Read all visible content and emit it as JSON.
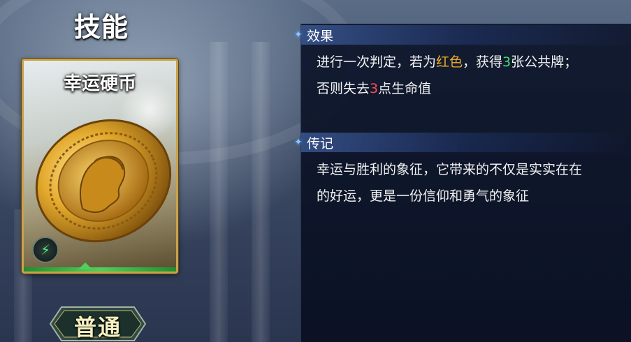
{
  "page_title": "技能",
  "card": {
    "name": "幸运硬币",
    "type_label": "普通",
    "energy_icon": "lightning-icon"
  },
  "effect": {
    "header": "效果",
    "line1_a": "进行一次判定，若为",
    "line1_b": "红色",
    "line1_c": "，获得",
    "line1_d": "3",
    "line1_e": "张公共牌；",
    "line2_a": "否则失去",
    "line2_b": "3",
    "line2_c": "点生命值"
  },
  "lore": {
    "header": "传记",
    "line1": "幸运与胜利的象征，它带来的不仅是实实在在",
    "line2": "的好运，更是一份信仰和勇气的象征"
  },
  "colors": {
    "accent_blue": "#8fc4ff",
    "highlight_word": "#f2b02a",
    "highlight_green": "#3fe06b",
    "highlight_red": "#ff4a5a"
  }
}
